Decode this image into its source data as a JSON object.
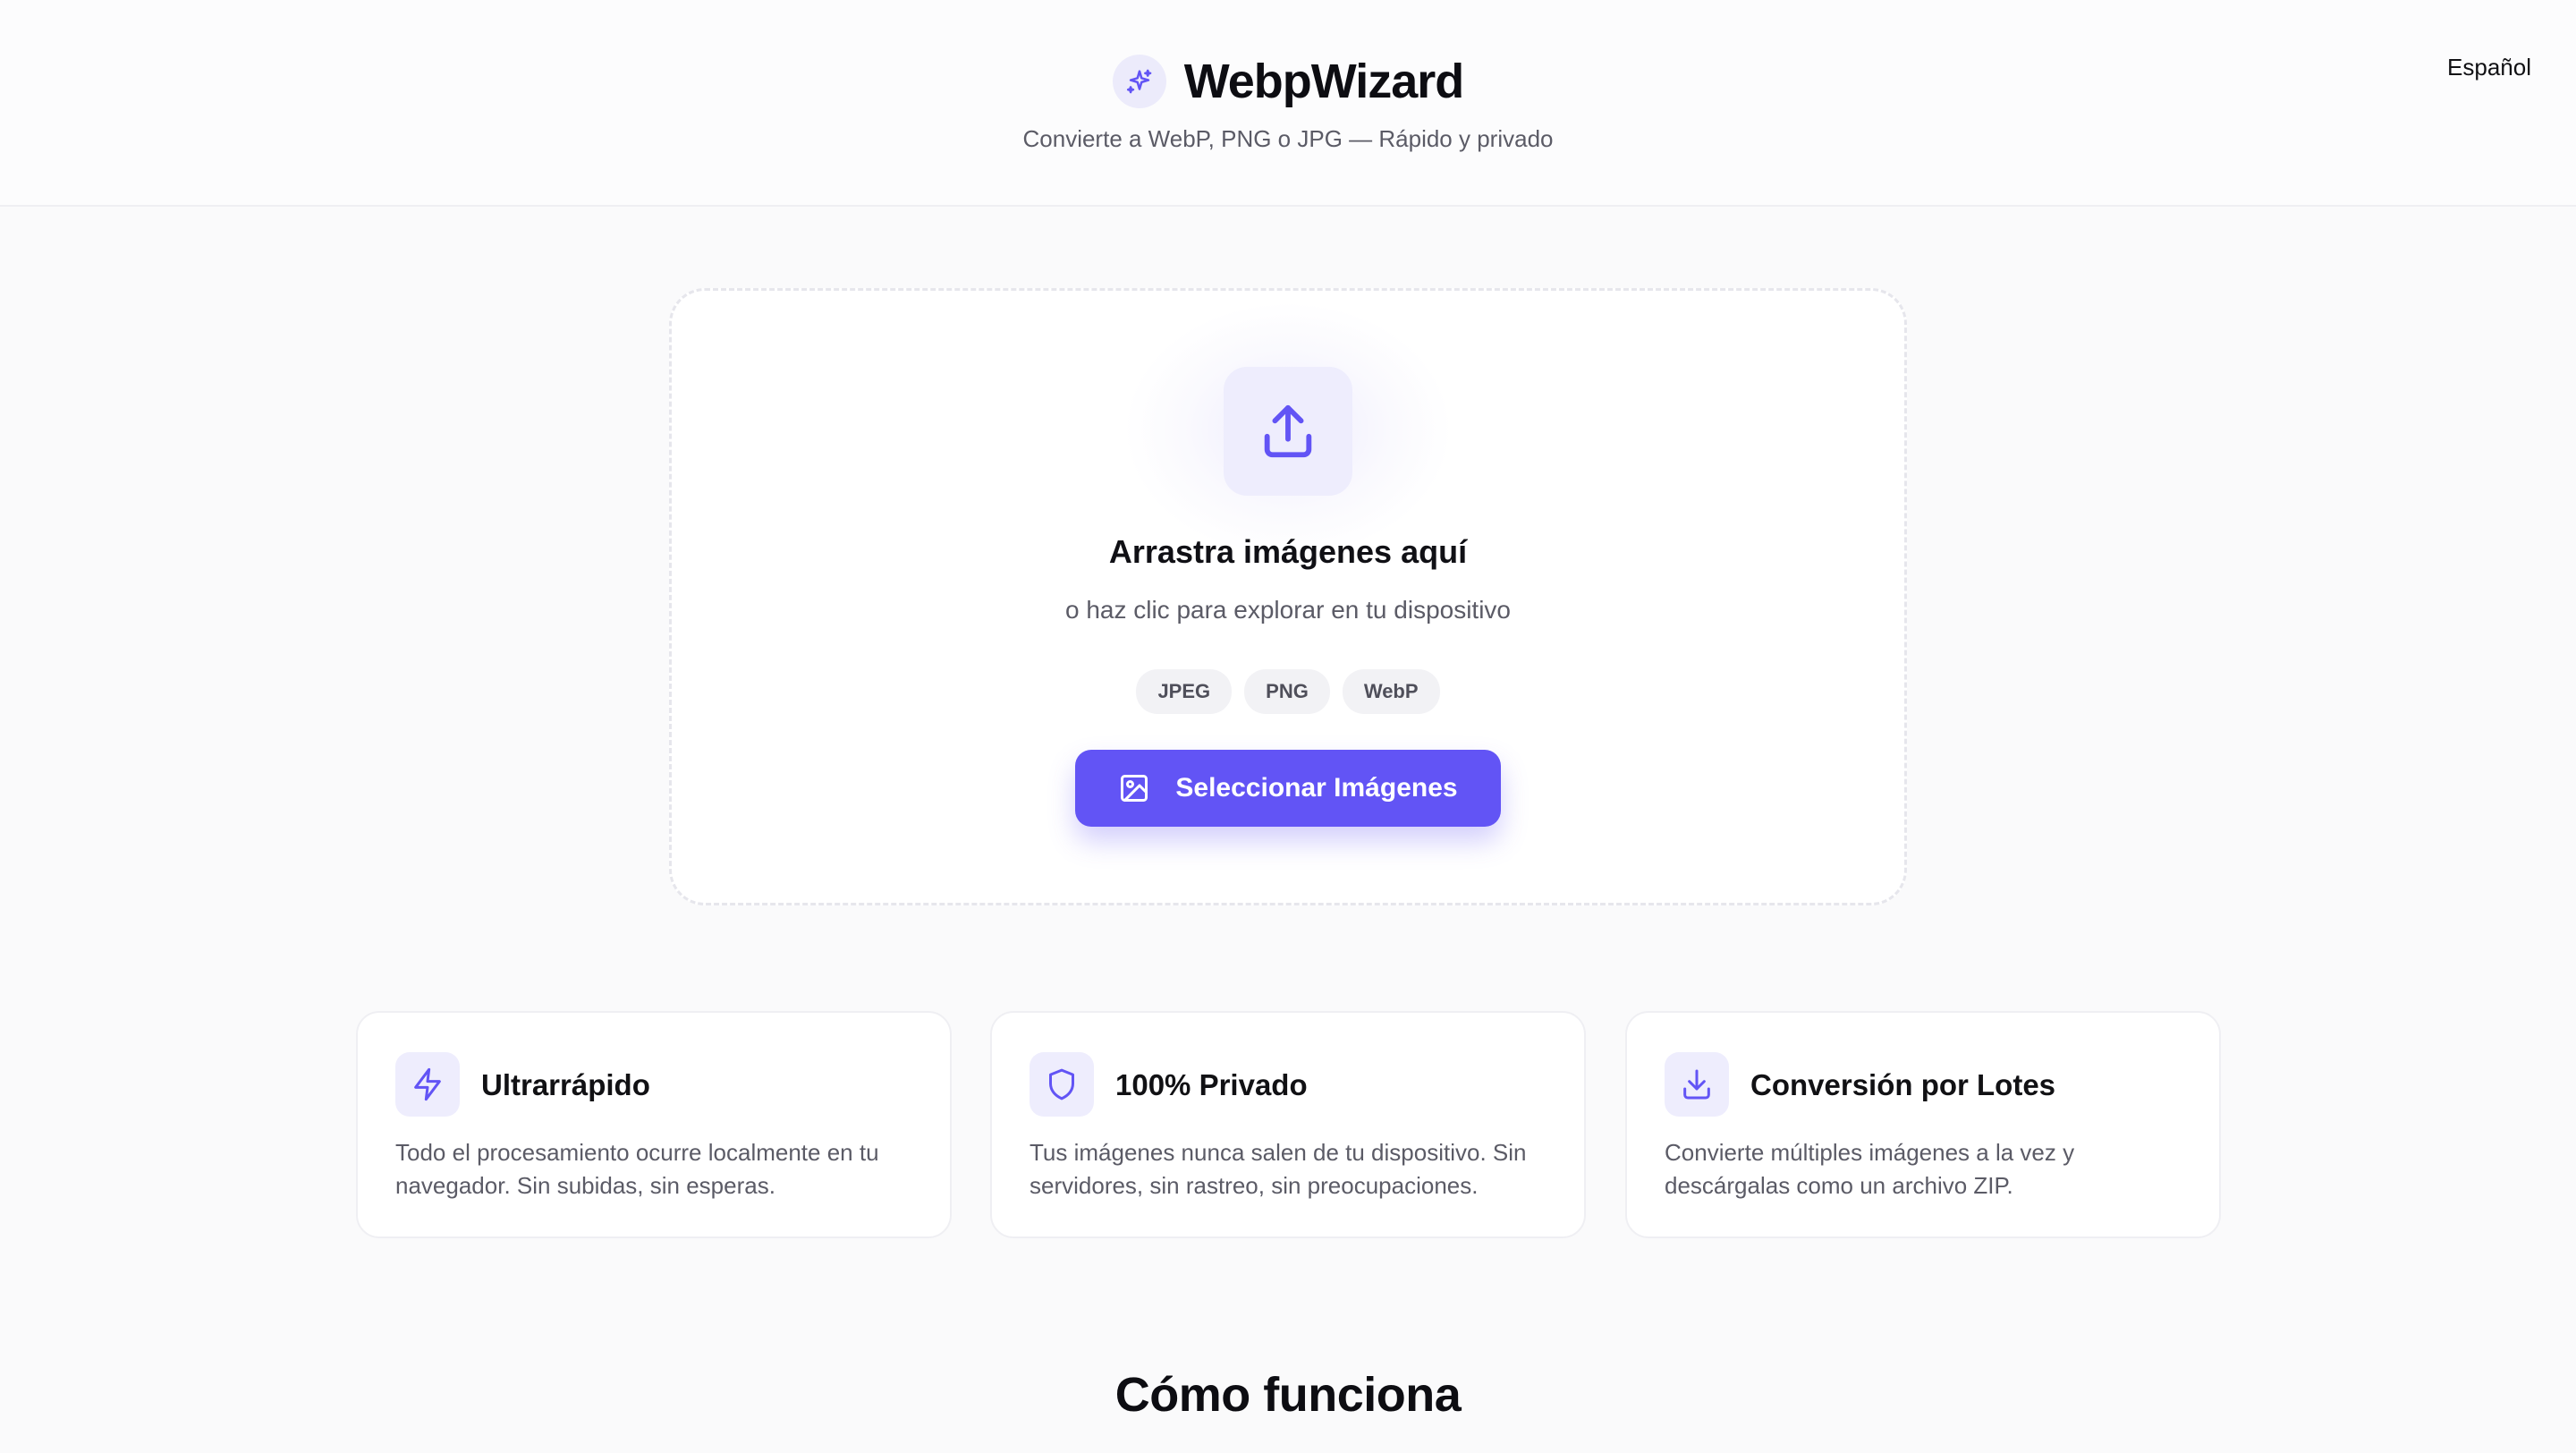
{
  "header": {
    "app_name": "WebpWizard",
    "subtitle": "Convierte a WebP, PNG o JPG — Rápido y privado",
    "language": "Español"
  },
  "dropzone": {
    "title": "Arrastra imágenes aquí",
    "subtitle": "o haz clic para explorar en tu dispositivo",
    "formats": [
      "JPEG",
      "PNG",
      "WebP"
    ],
    "button_label": "Seleccionar Imágenes"
  },
  "features": [
    {
      "icon": "lightning-icon",
      "title": "Ultrarrápido",
      "text": "Todo el procesamiento ocurre localmente en tu navegador. Sin subidas, sin esperas."
    },
    {
      "icon": "shield-icon",
      "title": "100% Privado",
      "text": "Tus imágenes nunca salen de tu dispositivo. Sin servidores, sin rastreo, sin preocupaciones."
    },
    {
      "icon": "download-icon",
      "title": "Conversión por Lotes",
      "text": "Convierte múltiples imágenes a la vez y descárgalas como un archivo ZIP."
    }
  ],
  "how_it_works": {
    "title": "Cómo funciona"
  },
  "colors": {
    "accent": "#6254f5",
    "accent_soft": "#eeedfd",
    "background": "#fafafb",
    "muted_text": "#5b5b66"
  }
}
